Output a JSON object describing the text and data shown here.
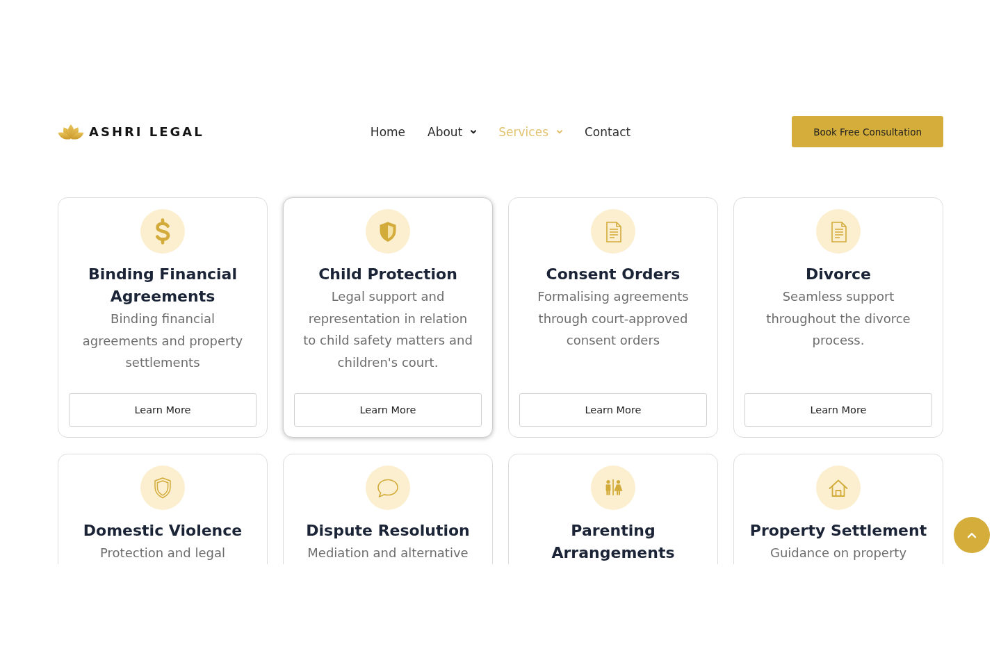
{
  "header": {
    "logo_text": "ASHRI LEGAL",
    "nav": [
      {
        "label": "Home",
        "selected": false,
        "dropdown": false
      },
      {
        "label": "About",
        "selected": false,
        "dropdown": true
      },
      {
        "label": "Services",
        "selected": true,
        "dropdown": true
      },
      {
        "label": "Contact",
        "selected": false,
        "dropdown": false
      }
    ],
    "cta_button": "Book Free Consultation"
  },
  "services": [
    {
      "title": "Binding Financial Agreements",
      "description": "Binding financial agreements and property settlements",
      "button": "Learn More",
      "hovered": false
    },
    {
      "title": "Child Protection",
      "description": "Legal support and representation in relation to child safety matters and children's court.",
      "button": "Learn More",
      "hovered": true
    },
    {
      "title": "Consent Orders",
      "description": "Formalising agreements through court-approved consent orders",
      "button": "Learn More",
      "hovered": false
    },
    {
      "title": "Divorce",
      "description": "Seamless support throughout the divorce process.",
      "button": "Learn More",
      "hovered": false
    },
    {
      "title": "Domestic Violence",
      "description": "Protection and legal",
      "hovered": false
    },
    {
      "title": "Dispute Resolution",
      "description": "Mediation and alternative",
      "hovered": false
    },
    {
      "title": "Parenting Arrangements",
      "hovered": false
    },
    {
      "title": "Property Settlement",
      "description": "Guidance on property",
      "hovered": false
    }
  ]
}
